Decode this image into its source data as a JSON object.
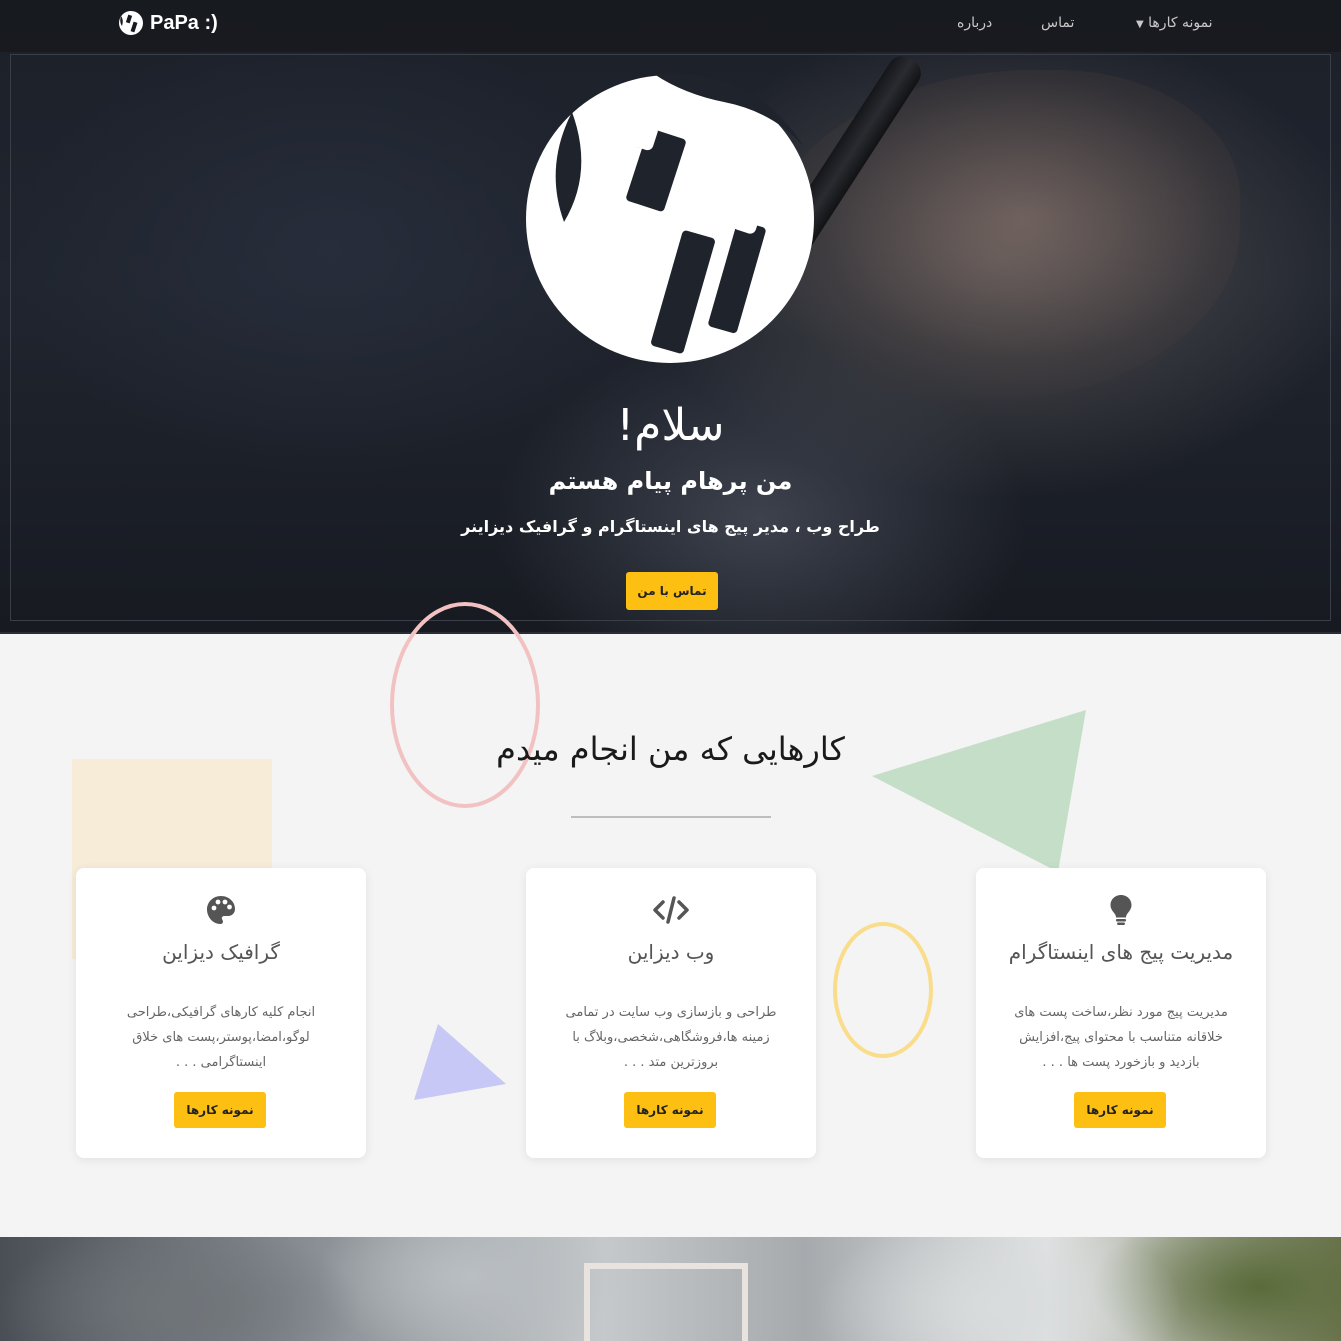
{
  "navbar": {
    "brand": "PaPa :)",
    "items": [
      {
        "label": "نمونه کارها",
        "dropdown": true
      },
      {
        "label": "تماس"
      },
      {
        "label": "درباره"
      }
    ]
  },
  "hero": {
    "hello": "سلام!",
    "name": "من پرهام پیام هستم",
    "subtitle": "طراح وب ، مدیر پیج های اینستاگرام و گرافیک دیزاینر",
    "button": "تماس با من"
  },
  "services": {
    "title": "کارهایی که من انجام میدم",
    "cards": [
      {
        "icon": "palette-icon",
        "title": "گرافیک دیزاین",
        "text": "انجام کلیه کارهای گرافیکی،طراحی لوگو،امضا،پوستر،پست های خلاق اینستاگرامی . . .",
        "button": "نمونه کارها"
      },
      {
        "icon": "code-icon",
        "title": "وب دیزاین",
        "text": "طراحی و بازسازی وب سایت در تمامی زمینه ها،فروشگاهی،شخصی،وبلاگ با بروزترین متد . . .",
        "button": "نمونه کارها"
      },
      {
        "icon": "lightbulb-icon",
        "title": "مدیریت پیج های اینستاگرام",
        "text": "مدیریت پیج مورد نظر،ساخت پست های خلاقانه متناسب با محتوای پیج،افزایش بازدید و بازخورد پست ها . . .",
        "button": "نمونه کارها"
      }
    ]
  },
  "colors": {
    "accent": "#fdbf12",
    "navbar": "#181a1f",
    "background": "#f4f4f4"
  }
}
